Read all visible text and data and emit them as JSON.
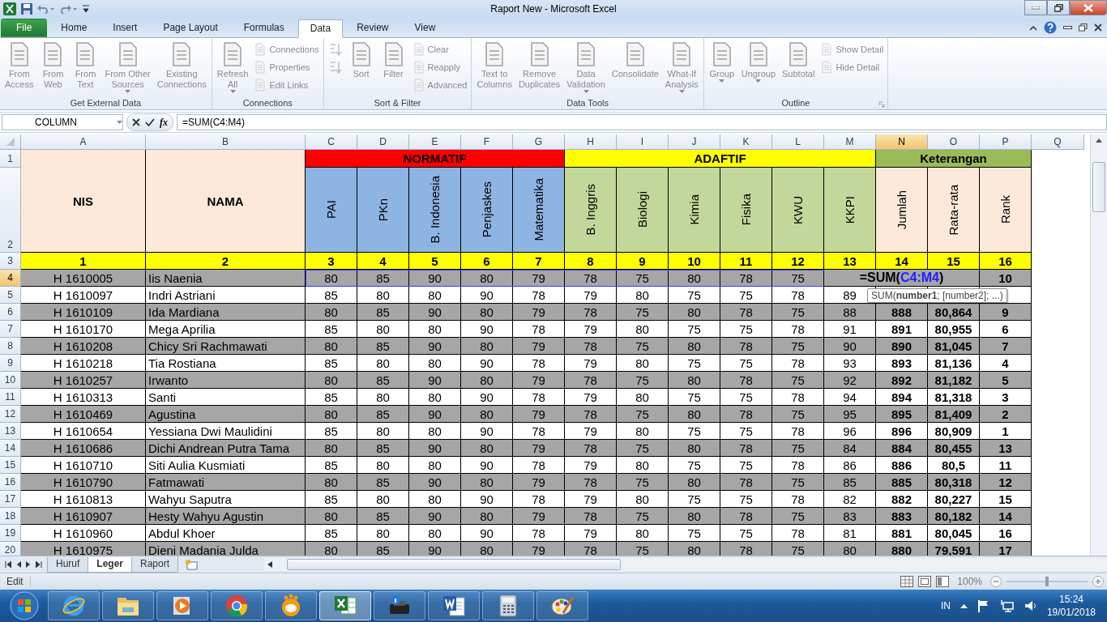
{
  "window": {
    "title": "Raport New - Microsoft Excel"
  },
  "ribbon_tabs": [
    {
      "label": "File",
      "selected": false
    },
    {
      "label": "Home",
      "selected": false
    },
    {
      "label": "Insert",
      "selected": false
    },
    {
      "label": "Page Layout",
      "selected": false
    },
    {
      "label": "Formulas",
      "selected": false
    },
    {
      "label": "Data",
      "selected": true
    },
    {
      "label": "Review",
      "selected": false
    },
    {
      "label": "View",
      "selected": false
    }
  ],
  "ribbon": {
    "groups": [
      {
        "label": "Get External Data",
        "launcher": false,
        "items": [
          {
            "kind": "large",
            "label": "From\nAccess",
            "disabled": true,
            "dropdown": false
          },
          {
            "kind": "large",
            "label": "From\nWeb",
            "disabled": true,
            "dropdown": false
          },
          {
            "kind": "large",
            "label": "From\nText",
            "disabled": true,
            "dropdown": false
          },
          {
            "kind": "large",
            "label": "From Other\nSources",
            "disabled": true,
            "dropdown": true
          },
          {
            "kind": "large",
            "label": "Existing\nConnections",
            "disabled": true,
            "dropdown": false
          }
        ]
      },
      {
        "label": "Connections",
        "launcher": false,
        "items": [
          {
            "kind": "large",
            "label": "Refresh\nAll",
            "disabled": true,
            "dropdown": true
          },
          {
            "kind": "small",
            "label": "Connections",
            "disabled": true
          },
          {
            "kind": "small",
            "label": "Properties",
            "disabled": true
          },
          {
            "kind": "small",
            "label": "Edit Links",
            "disabled": true
          }
        ]
      },
      {
        "label": "Sort & Filter",
        "launcher": false,
        "items": [
          {
            "kind": "icon",
            "disabled": true
          },
          {
            "kind": "icon",
            "disabled": true
          },
          {
            "kind": "large",
            "label": "Sort",
            "disabled": true,
            "dropdown": false
          },
          {
            "kind": "large",
            "label": "Filter",
            "disabled": true,
            "dropdown": false
          },
          {
            "kind": "small",
            "label": "Clear",
            "disabled": true
          },
          {
            "kind": "small",
            "label": "Reapply",
            "disabled": true
          },
          {
            "kind": "small",
            "label": "Advanced",
            "disabled": true
          }
        ]
      },
      {
        "label": "Data Tools",
        "launcher": false,
        "items": [
          {
            "kind": "large",
            "label": "Text to\nColumns",
            "disabled": true,
            "dropdown": false
          },
          {
            "kind": "large",
            "label": "Remove\nDuplicates",
            "disabled": true,
            "dropdown": false
          },
          {
            "kind": "large",
            "label": "Data\nValidation",
            "disabled": true,
            "dropdown": true
          },
          {
            "kind": "large",
            "label": "Consolidate",
            "disabled": true,
            "dropdown": false
          },
          {
            "kind": "large",
            "label": "What-If\nAnalysis",
            "disabled": true,
            "dropdown": true
          }
        ]
      },
      {
        "label": "Outline",
        "launcher": true,
        "items": [
          {
            "kind": "large",
            "label": "Group",
            "disabled": true,
            "dropdown": true
          },
          {
            "kind": "large",
            "label": "Ungroup",
            "disabled": true,
            "dropdown": true
          },
          {
            "kind": "large",
            "label": "Subtotal",
            "disabled": true,
            "dropdown": false
          },
          {
            "kind": "small",
            "label": "Show Detail",
            "disabled": true
          },
          {
            "kind": "small",
            "label": "Hide Detail",
            "disabled": true
          }
        ]
      }
    ]
  },
  "formula_bar": {
    "name_box": "COLUMN",
    "insert_function": "fx",
    "formula": "=SUM(C4:M4)"
  },
  "sheet": {
    "columns": [
      {
        "label": "A",
        "selected": false
      },
      {
        "label": "B",
        "selected": false
      },
      {
        "label": "C",
        "selected": false
      },
      {
        "label": "D",
        "selected": false
      },
      {
        "label": "E",
        "selected": false
      },
      {
        "label": "F",
        "selected": false
      },
      {
        "label": "G",
        "selected": false
      },
      {
        "label": "H",
        "selected": false
      },
      {
        "label": "I",
        "selected": false
      },
      {
        "label": "J",
        "selected": false
      },
      {
        "label": "K",
        "selected": false
      },
      {
        "label": "L",
        "selected": false
      },
      {
        "label": "M",
        "selected": false
      },
      {
        "label": "N",
        "selected": true
      },
      {
        "label": "O",
        "selected": false
      },
      {
        "label": "P",
        "selected": false
      },
      {
        "label": "Q",
        "selected": false
      }
    ],
    "row_headers": [
      {
        "label": "1",
        "selected": false
      },
      {
        "label": "2",
        "selected": false
      },
      {
        "label": "3",
        "selected": false
      },
      {
        "label": "4",
        "selected": true
      },
      {
        "label": "5",
        "selected": false
      },
      {
        "label": "6",
        "selected": false
      },
      {
        "label": "7",
        "selected": false
      },
      {
        "label": "8",
        "selected": false
      },
      {
        "label": "9",
        "selected": false
      },
      {
        "label": "10",
        "selected": false
      },
      {
        "label": "11",
        "selected": false
      },
      {
        "label": "12",
        "selected": false
      },
      {
        "label": "13",
        "selected": false
      },
      {
        "label": "14",
        "selected": false
      },
      {
        "label": "15",
        "selected": false
      },
      {
        "label": "16",
        "selected": false
      },
      {
        "label": "17",
        "selected": false
      },
      {
        "label": "18",
        "selected": false
      },
      {
        "label": "19",
        "selected": false
      },
      {
        "label": "20",
        "selected": false
      }
    ],
    "header": {
      "nis": "NIS",
      "name": "NAMA",
      "groups": [
        {
          "label": "NORMATIF",
          "color": "#ff0000",
          "subjects": [
            "PAI",
            "PKn",
            "B. Indonesia",
            "Penjaskes",
            "Matematika"
          ]
        },
        {
          "label": "ADAFTIF",
          "color": "#ffff00",
          "subjects": [
            "B. Inggris",
            "Biologi",
            "Kimia",
            "Fisika",
            "KWU",
            "KKPI"
          ]
        },
        {
          "label": "Keterangan",
          "color": "#9bbb59",
          "subjects": [
            "Jumlah",
            "Rata-rata",
            "Rank"
          ]
        }
      ],
      "numbers": [
        "1",
        "2",
        "3",
        "4",
        "5",
        "6",
        "7",
        "8",
        "9",
        "10",
        "11",
        "12",
        "13",
        "14",
        "15",
        "16"
      ]
    },
    "rows": [
      {
        "nis": "H 1610005",
        "name": "Iis Naenia",
        "scores": [
          "80",
          "85",
          "90",
          "80",
          "79",
          "78",
          "75",
          "80",
          "78",
          "75"
        ],
        "editing": {
          "before": "=SUM(",
          "ref": "C4:M4",
          "after": ")"
        },
        "rank": "10",
        "shaded": true
      },
      {
        "nis": "H 1610097",
        "name": "Indri Astriani",
        "scores": [
          "85",
          "80",
          "80",
          "90",
          "78",
          "79",
          "80",
          "75",
          "75",
          "78",
          "89"
        ],
        "shaded": false
      },
      {
        "nis": "H 1610109",
        "name": "Ida Mardiana",
        "scores": [
          "80",
          "85",
          "90",
          "80",
          "79",
          "78",
          "75",
          "80",
          "78",
          "75",
          "88"
        ],
        "total": "888",
        "average": "80,864",
        "rank": "9",
        "shaded": true
      },
      {
        "nis": "H 1610170",
        "name": "Mega Aprilia",
        "scores": [
          "85",
          "80",
          "80",
          "90",
          "78",
          "79",
          "80",
          "75",
          "75",
          "78",
          "91"
        ],
        "total": "891",
        "average": "80,955",
        "rank": "6",
        "shaded": false
      },
      {
        "nis": "H 1610208",
        "name": "Chicy Sri Rachmawati",
        "scores": [
          "80",
          "85",
          "90",
          "80",
          "79",
          "78",
          "75",
          "80",
          "78",
          "75",
          "90"
        ],
        "total": "890",
        "average": "81,045",
        "rank": "7",
        "shaded": true
      },
      {
        "nis": "H 1610218",
        "name": "Tia Rostiana",
        "scores": [
          "85",
          "80",
          "80",
          "90",
          "78",
          "79",
          "80",
          "75",
          "75",
          "78",
          "93"
        ],
        "total": "893",
        "average": "81,136",
        "rank": "4",
        "shaded": false
      },
      {
        "nis": "H 1610257",
        "name": "Irwanto",
        "scores": [
          "80",
          "85",
          "90",
          "80",
          "79",
          "78",
          "75",
          "80",
          "78",
          "75",
          "92"
        ],
        "total": "892",
        "average": "81,182",
        "rank": "5",
        "shaded": true
      },
      {
        "nis": "H 1610313",
        "name": "Santi",
        "scores": [
          "85",
          "80",
          "80",
          "90",
          "78",
          "79",
          "80",
          "75",
          "75",
          "78",
          "94"
        ],
        "total": "894",
        "average": "81,318",
        "rank": "3",
        "shaded": false
      },
      {
        "nis": "H 1610469",
        "name": "Agustina",
        "scores": [
          "80",
          "85",
          "90",
          "80",
          "79",
          "78",
          "75",
          "80",
          "78",
          "75",
          "95"
        ],
        "total": "895",
        "average": "81,409",
        "rank": "2",
        "shaded": true
      },
      {
        "nis": "H 1610654",
        "name": "Yessiana Dwi Maulidini",
        "scores": [
          "85",
          "80",
          "80",
          "90",
          "78",
          "79",
          "80",
          "75",
          "75",
          "78",
          "96"
        ],
        "total": "896",
        "average": "80,909",
        "rank": "1",
        "shaded": false
      },
      {
        "nis": "H 1610686",
        "name": "Dichi Andrean Putra Tama",
        "scores": [
          "80",
          "85",
          "90",
          "80",
          "79",
          "78",
          "75",
          "80",
          "78",
          "75",
          "84"
        ],
        "total": "884",
        "average": "80,455",
        "rank": "13",
        "shaded": true
      },
      {
        "nis": "H 1610710",
        "name": "Siti Aulia Kusmiati",
        "scores": [
          "85",
          "80",
          "80",
          "90",
          "78",
          "79",
          "80",
          "75",
          "75",
          "78",
          "86"
        ],
        "total": "886",
        "average": "80,5",
        "rank": "11",
        "shaded": false
      },
      {
        "nis": "H 1610790",
        "name": "Fatmawati",
        "scores": [
          "80",
          "85",
          "90",
          "80",
          "79",
          "78",
          "75",
          "80",
          "78",
          "75",
          "85"
        ],
        "total": "885",
        "average": "80,318",
        "rank": "12",
        "shaded": true
      },
      {
        "nis": "H 1610813",
        "name": "Wahyu Saputra",
        "scores": [
          "85",
          "80",
          "80",
          "90",
          "78",
          "79",
          "80",
          "75",
          "75",
          "78",
          "82"
        ],
        "total": "882",
        "average": "80,227",
        "rank": "15",
        "shaded": false
      },
      {
        "nis": "H 1610907",
        "name": "Hesty Wahyu Agustin",
        "scores": [
          "80",
          "85",
          "90",
          "80",
          "79",
          "78",
          "75",
          "80",
          "78",
          "75",
          "83"
        ],
        "total": "883",
        "average": "80,182",
        "rank": "14",
        "shaded": true
      },
      {
        "nis": "H 1610960",
        "name": "Abdul Khoer",
        "scores": [
          "85",
          "80",
          "80",
          "90",
          "78",
          "79",
          "80",
          "75",
          "75",
          "78",
          "81"
        ],
        "total": "881",
        "average": "80,045",
        "rank": "16",
        "shaded": false
      },
      {
        "nis": "H 1610975",
        "name": "Dieni Madania Julda",
        "scores": [
          "80",
          "85",
          "90",
          "80",
          "79",
          "78",
          "75",
          "80",
          "78",
          "75",
          "80"
        ],
        "total": "880",
        "average": "79,591",
        "rank": "17",
        "shaded": true
      }
    ],
    "formula_tooltip": "SUM(**number1**; [number2]; ...)"
  },
  "sheet_tabs": [
    {
      "label": "Huruf",
      "selected": false
    },
    {
      "label": "Leger",
      "selected": true
    },
    {
      "label": "Raport",
      "selected": false
    }
  ],
  "status_bar": {
    "mode": "Edit",
    "zoom": "100%",
    "zoom_slider": {
      "level": 0.5
    }
  },
  "taskbar": {
    "apps": [
      {
        "kind": "browser",
        "selected": false
      },
      {
        "kind": "folder",
        "selected": false
      },
      {
        "kind": "media",
        "selected": false
      },
      {
        "kind": "chrome",
        "selected": false
      },
      {
        "kind": "ball",
        "selected": false
      },
      {
        "kind": "spreadsheet",
        "selected": true
      },
      {
        "kind": "printer",
        "selected": false
      },
      {
        "kind": "word",
        "selected": false
      },
      {
        "kind": "calculator",
        "selected": false
      },
      {
        "kind": "paint",
        "selected": false
      }
    ],
    "tray": {
      "language": "IN",
      "time": "15:24",
      "date": "19/01/2018"
    }
  }
}
